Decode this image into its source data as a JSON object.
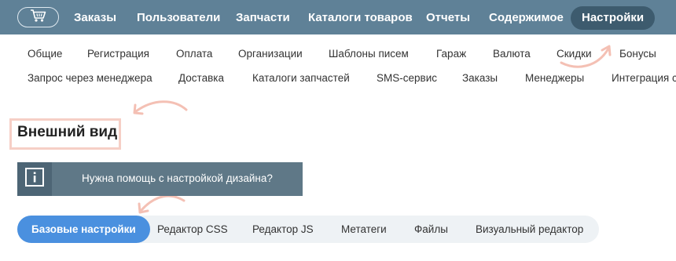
{
  "topnav": {
    "cart_icon": "shopping-cart-icon",
    "items": [
      {
        "label": "Заказы"
      },
      {
        "label": "Пользователи"
      },
      {
        "label": "Запчасти"
      },
      {
        "label": "Каталоги товаров"
      },
      {
        "label": "Отчеты"
      },
      {
        "label": "Содержимое"
      },
      {
        "label": "Настройки",
        "active": true
      }
    ]
  },
  "subnav": {
    "row1": [
      "Общие",
      "Регистрация",
      "Оплата",
      "Организации",
      "Шаблоны писем",
      "Гараж",
      "Валюта",
      "Скидки",
      "Бонусы"
    ],
    "row2": [
      "Запрос через менеджера",
      "Доставка",
      "Каталоги запчастей",
      "SMS-сервис",
      "Заказы",
      "Менеджеры",
      "Интеграция с"
    ]
  },
  "page": {
    "title": "Внешний вид"
  },
  "help": {
    "icon": "info-icon",
    "text": "Нужна помощь с настройкой дизайна?"
  },
  "tabs": [
    {
      "label": "Базовые настройки",
      "active": true
    },
    {
      "label": "Редактор CSS"
    },
    {
      "label": "Редактор JS"
    },
    {
      "label": "Метатеги"
    },
    {
      "label": "Файлы"
    },
    {
      "label": "Визуальный редактор"
    }
  ],
  "colors": {
    "nav_bg": "#5f8197",
    "nav_active": "#3d5b6e",
    "accent": "#4a90df",
    "highlight": "#f6cfc6"
  }
}
